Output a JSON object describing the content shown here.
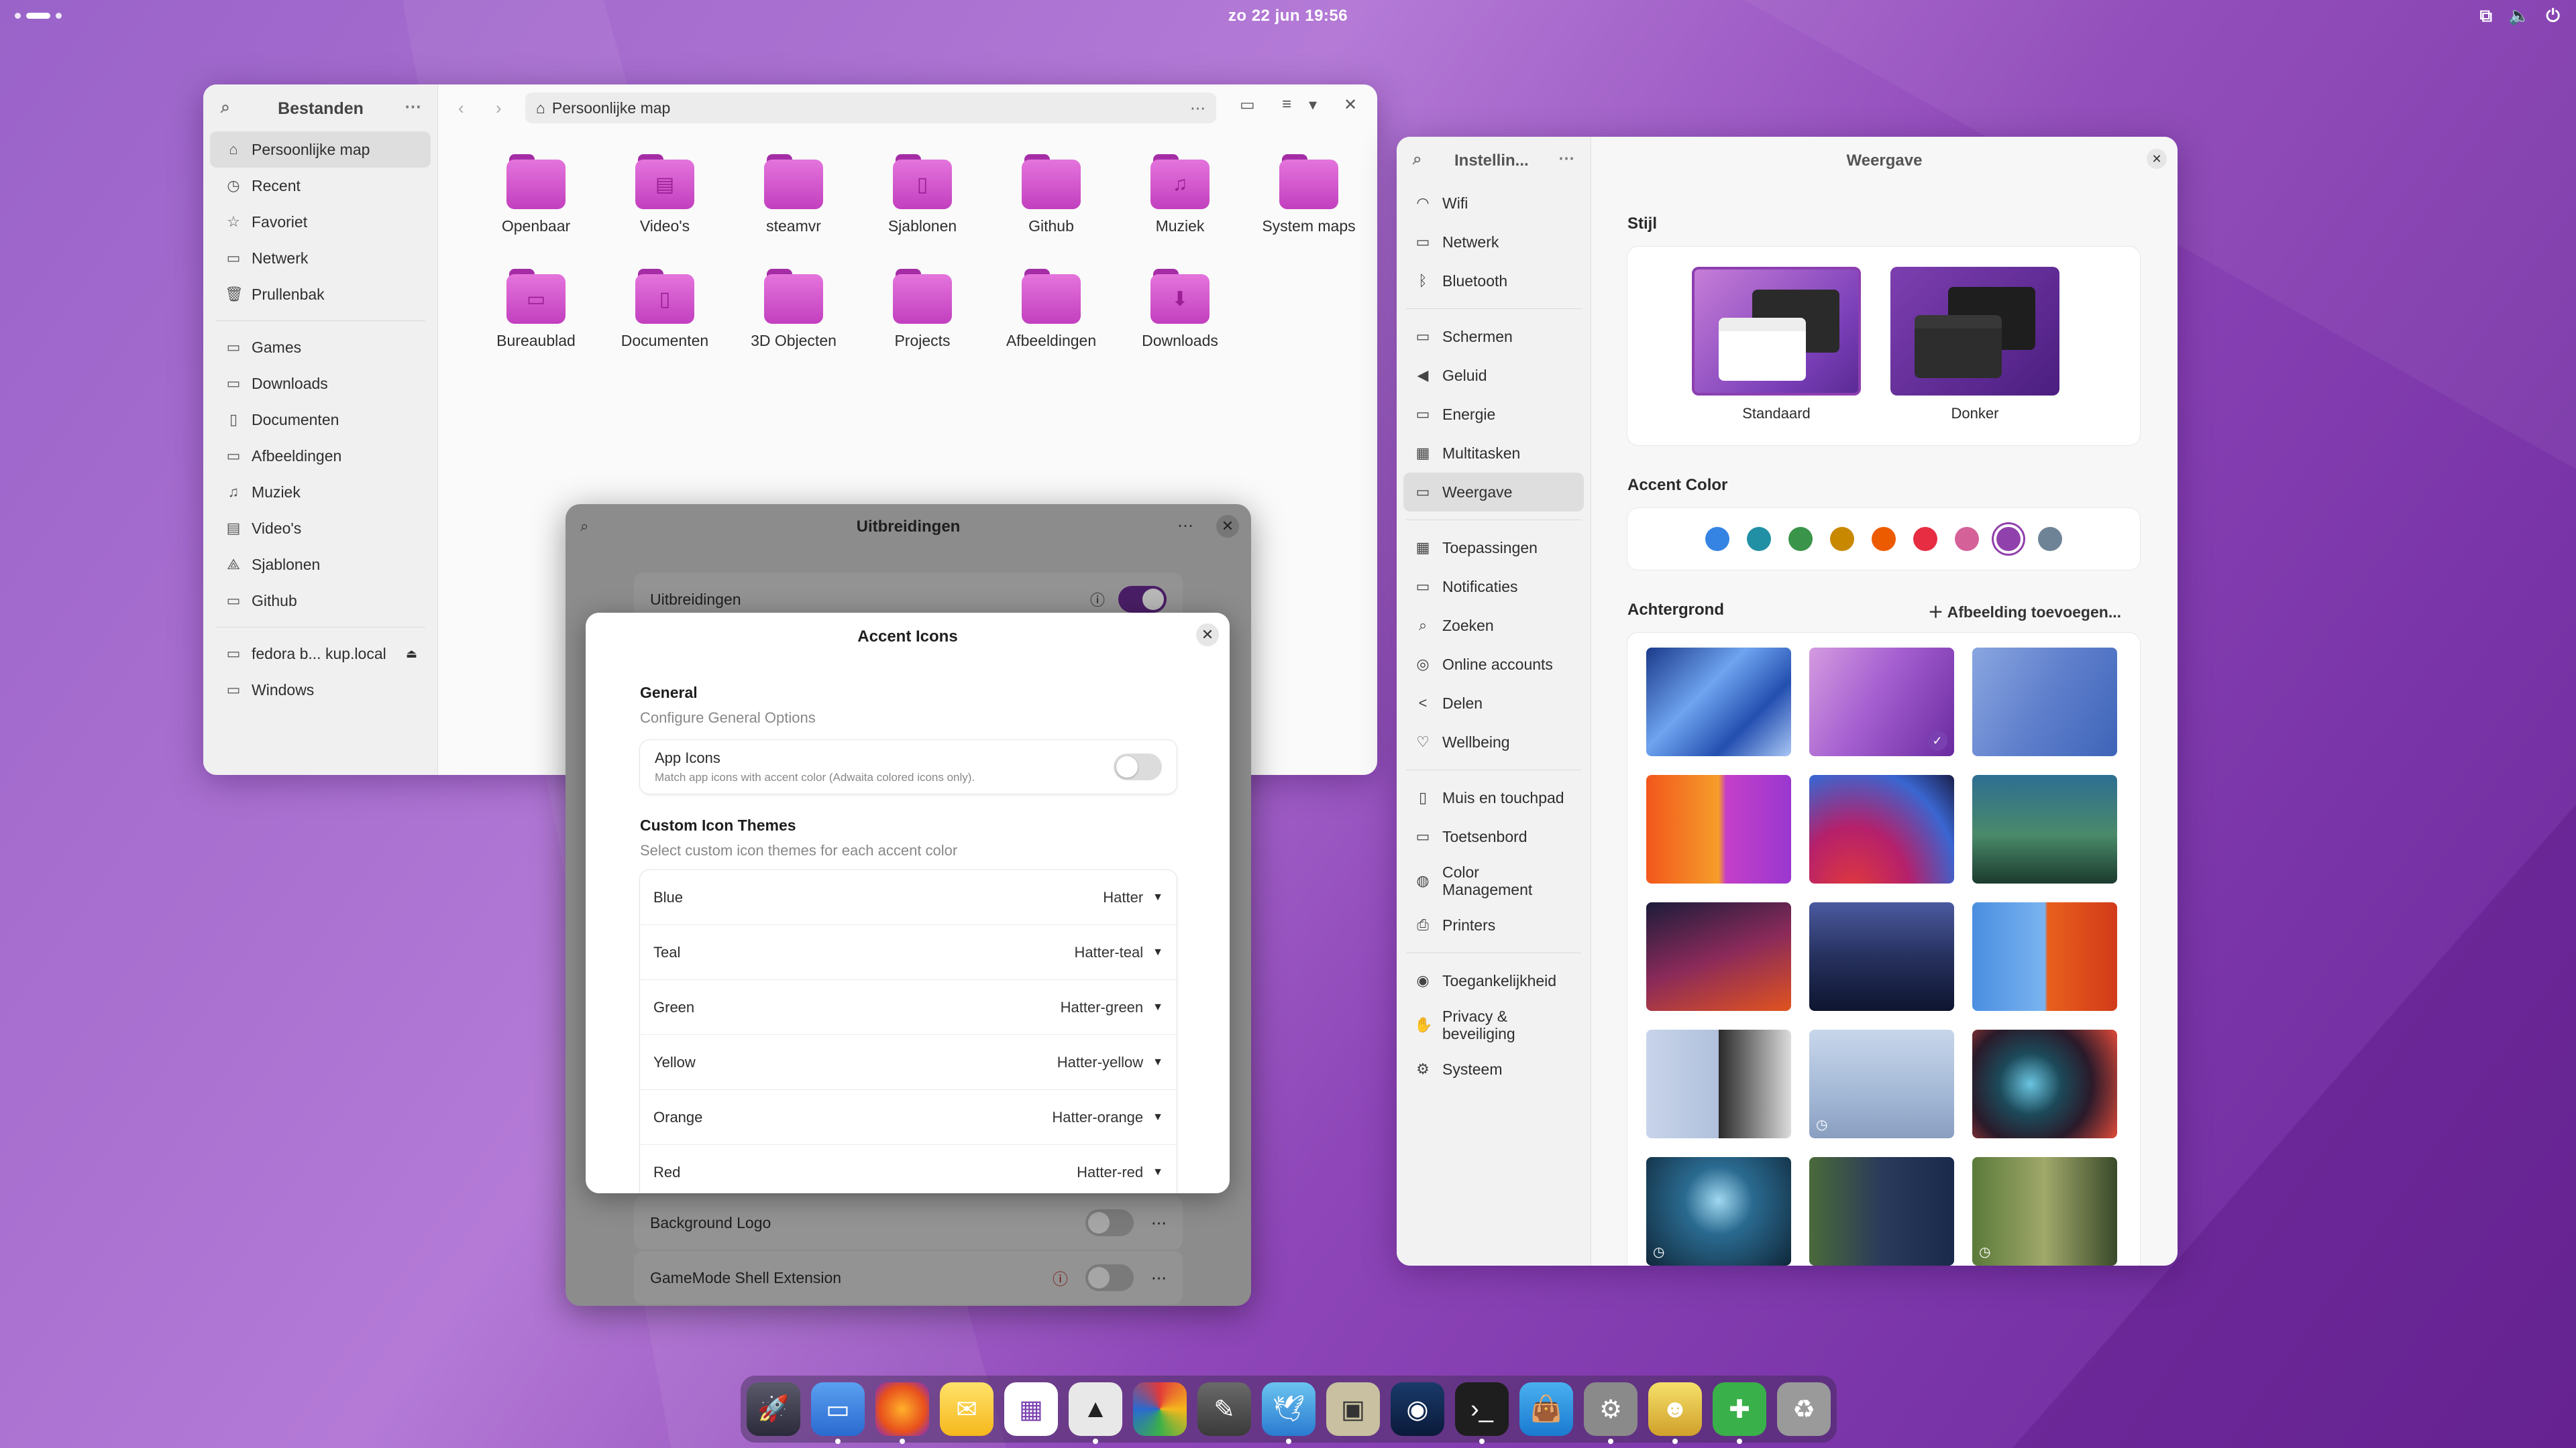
{
  "topbar": {
    "clock": "zo 22 jun  19:56"
  },
  "files": {
    "title": "Bestanden",
    "path": "Persoonlijke map",
    "places": [
      {
        "label": "Persoonlijke map",
        "icon": "⌂"
      },
      {
        "label": "Recent",
        "icon": "◷"
      },
      {
        "label": "Favoriet",
        "icon": "☆"
      },
      {
        "label": "Netwerk",
        "icon": "▭"
      },
      {
        "label": "Prullenbak",
        "icon": "🗑"
      }
    ],
    "bookmarks": [
      {
        "label": "Games",
        "icon": "▭"
      },
      {
        "label": "Downloads",
        "icon": "▭"
      },
      {
        "label": "Documenten",
        "icon": "▯"
      },
      {
        "label": "Afbeeldingen",
        "icon": "▭"
      },
      {
        "label": "Muziek",
        "icon": "♫"
      },
      {
        "label": "Video's",
        "icon": "▤"
      },
      {
        "label": "Sjablonen",
        "icon": "⟁"
      },
      {
        "label": "Github",
        "icon": "▭"
      }
    ],
    "devices": [
      {
        "label": "fedora b... kup.local",
        "icon": "▭"
      },
      {
        "label": "Windows",
        "icon": "▭"
      }
    ],
    "folders": [
      {
        "label": "Openbaar",
        "glyph": ""
      },
      {
        "label": "Video's",
        "glyph": "▤"
      },
      {
        "label": "steamvr",
        "glyph": ""
      },
      {
        "label": "Sjablonen",
        "glyph": "▯"
      },
      {
        "label": "Github",
        "glyph": ""
      },
      {
        "label": "Muziek",
        "glyph": "♫"
      },
      {
        "label": "System maps",
        "glyph": ""
      },
      {
        "label": "Bureaublad",
        "glyph": "▭"
      },
      {
        "label": "Documenten",
        "glyph": "▯"
      },
      {
        "label": "3D Objecten",
        "glyph": ""
      },
      {
        "label": "Projects",
        "glyph": ""
      },
      {
        "label": "Afbeeldingen",
        "glyph": ""
      },
      {
        "label": "Downloads",
        "glyph": "⬇"
      }
    ]
  },
  "extensions": {
    "title": "Uitbreidingen",
    "master_label": "Uitbreidingen",
    "rows": [
      {
        "label": "Background Logo"
      },
      {
        "label": "GameMode Shell Extension"
      }
    ]
  },
  "dialog": {
    "title": "Accent Icons",
    "general_heading": "General",
    "general_sub": "Configure General Options",
    "app_icons_label": "App Icons",
    "app_icons_desc": "Match app icons with accent color (Adwaita colored icons only).",
    "custom_heading": "Custom Icon Themes",
    "custom_sub": "Select custom icon themes for each accent color",
    "themes": [
      {
        "label": "Blue",
        "value": "Hatter"
      },
      {
        "label": "Teal",
        "value": "Hatter-teal"
      },
      {
        "label": "Green",
        "value": "Hatter-green"
      },
      {
        "label": "Yellow",
        "value": "Hatter-yellow"
      },
      {
        "label": "Orange",
        "value": "Hatter-orange"
      },
      {
        "label": "Red",
        "value": "Hatter-red"
      }
    ]
  },
  "settings": {
    "sidebar_title": "Instellin...",
    "page_title": "Weergave",
    "nav": [
      [
        {
          "label": "Wifi",
          "icon": "◠"
        },
        {
          "label": "Netwerk",
          "icon": "▭"
        },
        {
          "label": "Bluetooth",
          "icon": "ᛒ"
        }
      ],
      [
        {
          "label": "Schermen",
          "icon": "▭"
        },
        {
          "label": "Geluid",
          "icon": "◀"
        },
        {
          "label": "Energie",
          "icon": "▭"
        },
        {
          "label": "Multitasken",
          "icon": "▦"
        },
        {
          "label": "Weergave",
          "icon": "▭"
        }
      ],
      [
        {
          "label": "Toepassingen",
          "icon": "▦"
        },
        {
          "label": "Notificaties",
          "icon": "▭"
        },
        {
          "label": "Zoeken",
          "icon": "⌕"
        },
        {
          "label": "Online accounts",
          "icon": "◎"
        },
        {
          "label": "Delen",
          "icon": "<"
        },
        {
          "label": "Wellbeing",
          "icon": "♡"
        }
      ],
      [
        {
          "label": "Muis en touchpad",
          "icon": "▯"
        },
        {
          "label": "Toetsenbord",
          "icon": "▭"
        },
        {
          "label": "Color\nManagement",
          "icon": "◍"
        },
        {
          "label": "Printers",
          "icon": "⎙"
        }
      ],
      [
        {
          "label": "Toegankelijkheid",
          "icon": "◉"
        },
        {
          "label": "Privacy &\nbeveiliging",
          "icon": "✋"
        },
        {
          "label": "Systeem",
          "icon": "⚙"
        }
      ]
    ],
    "style_heading": "Stijl",
    "style_standard": "Standaard",
    "style_dark": "Donker",
    "accent_heading": "Accent Color",
    "accent_colors": [
      "#3584e4",
      "#2190a4",
      "#3a944a",
      "#c88800",
      "#ed5b00",
      "#e62d42",
      "#d56199",
      "#9141ac",
      "#6f8396"
    ],
    "accent_selected_index": 7,
    "background_heading": "Achtergrond",
    "add_background": "Afbeelding toevoegen..."
  }
}
